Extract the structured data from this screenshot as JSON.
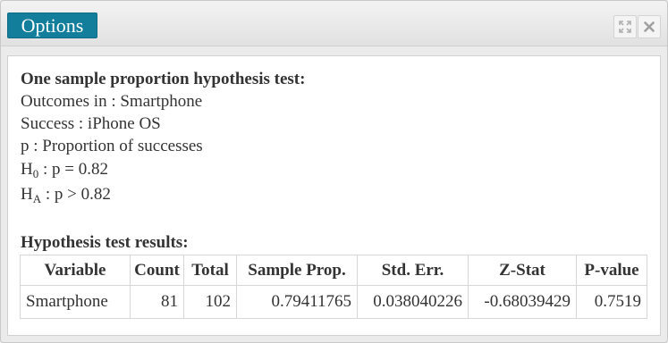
{
  "window": {
    "options_label": "Options",
    "controls": [
      {
        "icon": "expand-icon"
      },
      {
        "icon": "close-icon"
      }
    ]
  },
  "test": {
    "heading": "One sample proportion hypothesis test:",
    "outcomes": "Outcomes in : Smartphone",
    "success": "Success : iPhone OS",
    "p_def": "p : Proportion of successes",
    "h0_prefix": "H",
    "h0_sub": "0",
    "h0_text": " : p = 0.82",
    "ha_prefix": "H",
    "ha_sub": "A",
    "ha_text": " : p > 0.82"
  },
  "results": {
    "heading": "Hypothesis test results:",
    "columns": [
      "Variable",
      "Count",
      "Total",
      "Sample Prop.",
      "Std. Err.",
      "Z-Stat",
      "P-value"
    ],
    "rows": [
      [
        "Smartphone",
        "81",
        "102",
        "0.79411765",
        "0.038040226",
        "-0.68039429",
        "0.7519"
      ]
    ]
  },
  "colors": {
    "accent": "#137e9c",
    "text": "#333333",
    "background": "#ebebeb"
  }
}
